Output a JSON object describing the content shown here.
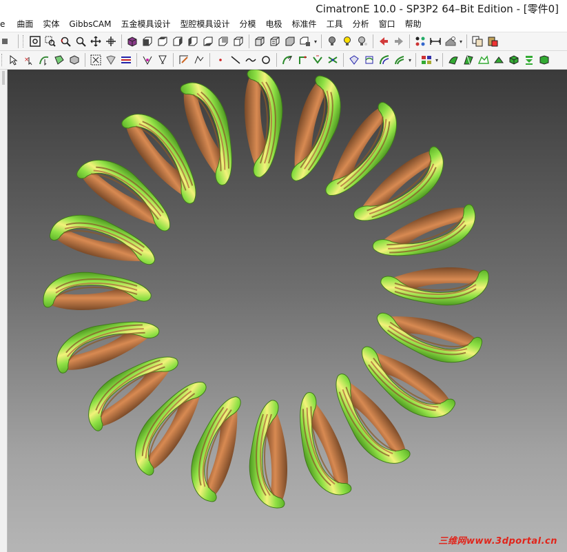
{
  "window": {
    "title": "CimatronE 10.0 - SP3P2 64–Bit Edition - [零件0]"
  },
  "menu": {
    "items": [
      "e",
      "曲面",
      "实体",
      "GibbsCAM",
      "五金模具设计",
      "型腔模具设计",
      "分模",
      "电极",
      "标准件",
      "工具",
      "分析",
      "窗口",
      "帮助"
    ]
  },
  "toolbar1": {
    "icons": [
      "zoom-fit-icon",
      "zoom-window-icon",
      "zoom-previous-icon",
      "zoom-icon",
      "pan-icon",
      "rotate-icon",
      "view-iso-icon",
      "view-front-icon",
      "view-top-icon",
      "view-right-icon",
      "view-left-icon",
      "view-bottom-icon",
      "view-back-icon",
      "view-dynamic-icon",
      "render-shaded-icon",
      "render-wire-icon",
      "render-hidden-icon",
      "render-box-icon",
      "render-select-icon",
      "light-icon",
      "light-on-icon",
      "light-multi-icon",
      "arrow-left-icon",
      "arrow-right-icon",
      "layer-icon",
      "measure-icon",
      "settings-icon",
      "copy-icon",
      "paste-icon"
    ]
  },
  "toolbar2": {
    "icons": [
      "select-icon",
      "select-plus-icon",
      "select-curve-icon",
      "select-face-icon",
      "select-body-icon",
      "filter-icon",
      "filter-2-icon",
      "list-icon",
      "snap-icon",
      "snap-2-icon",
      "sketch-icon",
      "sketch-2-icon",
      "point-icon",
      "line-icon",
      "spline-icon",
      "circle-icon",
      "curve-1-icon",
      "curve-2-icon",
      "curve-3-icon",
      "curve-4-icon",
      "surface-1-icon",
      "surface-2-icon",
      "surface-3-icon",
      "surface-4-icon",
      "grid-icon",
      "solid-1-icon",
      "solid-2-icon",
      "solid-3-icon",
      "solid-4-icon",
      "solid-5-icon",
      "solid-6-icon",
      "solid-7-icon"
    ]
  },
  "watermark": {
    "text": "三维网www.3dportal.cn"
  },
  "colors": {
    "spring_green": "#7fd83a",
    "spring_yellow": "#f2f27a",
    "spring_bronze": "#b06a3c",
    "viewport_top": "#3a3a3a",
    "viewport_bottom": "#b5b5b5",
    "watermark": "#e0251b"
  }
}
